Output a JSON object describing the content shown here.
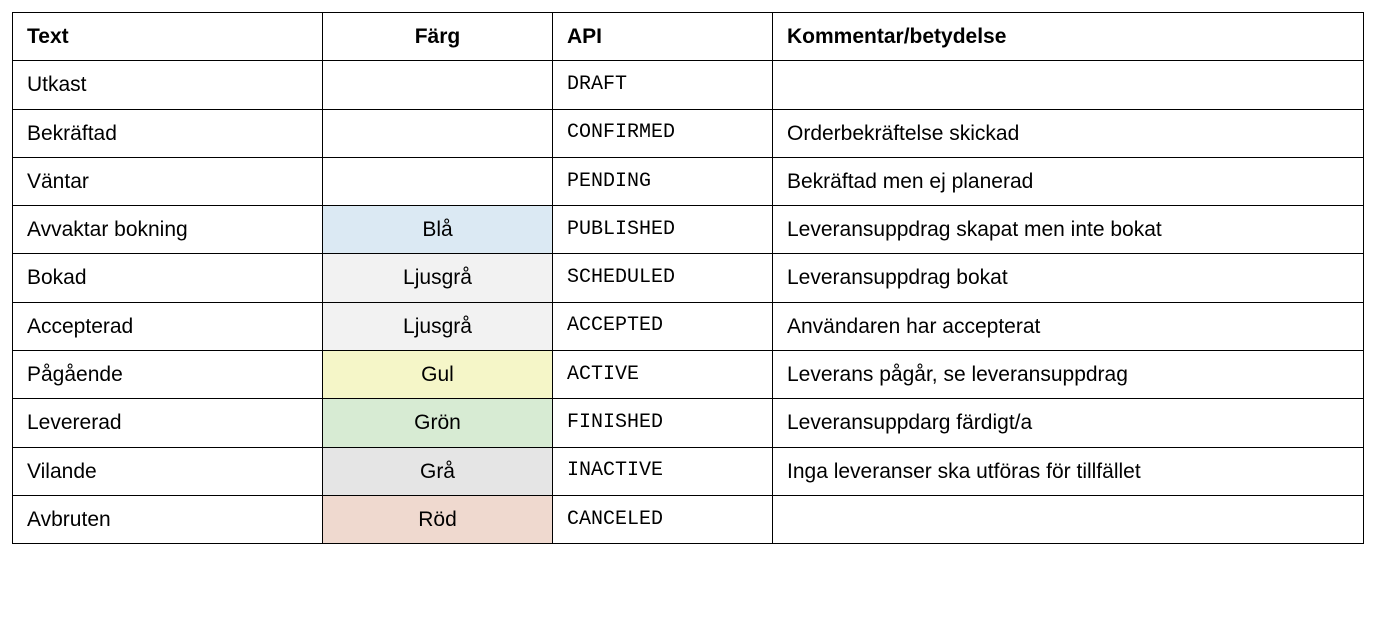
{
  "table": {
    "headers": {
      "text": "Text",
      "farg": "Färg",
      "api": "API",
      "kommentar": "Kommentar/betydelse"
    },
    "rows": [
      {
        "text": "Utkast",
        "farg": "",
        "api": "DRAFT",
        "kommentar": "",
        "farg_class": ""
      },
      {
        "text": "Bekräftad",
        "farg": "",
        "api": "CONFIRMED",
        "kommentar": "Orderbekräftelse skickad",
        "farg_class": ""
      },
      {
        "text": "Väntar",
        "farg": "",
        "api": "PENDING",
        "kommentar": "Bekräftad men ej planerad",
        "farg_class": ""
      },
      {
        "text": "Avvaktar bokning",
        "farg": "Blå",
        "api": "PUBLISHED",
        "kommentar": "Leveransuppdrag skapat men inte bokat",
        "farg_class": "bg-blue"
      },
      {
        "text": "Bokad",
        "farg": "Ljusgrå",
        "api": "SCHEDULED",
        "kommentar": "Leveransuppdrag bokat",
        "farg_class": "bg-lgrey"
      },
      {
        "text": "Accepterad",
        "farg": "Ljusgrå",
        "api": "ACCEPTED",
        "kommentar": "Användaren har accepterat",
        "farg_class": "bg-lgrey"
      },
      {
        "text": "Pågående",
        "farg": "Gul",
        "api": "ACTIVE",
        "kommentar": "Leverans pågår, se leveransuppdrag",
        "farg_class": "bg-yellow"
      },
      {
        "text": "Levererad",
        "farg": "Grön",
        "api": "FINISHED",
        "kommentar": "Leveransuppdarg färdigt/a",
        "farg_class": "bg-green"
      },
      {
        "text": "Vilande",
        "farg": "Grå",
        "api": "INACTIVE",
        "kommentar": "Inga leveranser ska utföras för tillfället",
        "farg_class": "bg-grey"
      },
      {
        "text": "Avbruten",
        "farg": "Röd",
        "api": "CANCELED",
        "kommentar": "",
        "farg_class": "bg-red"
      }
    ]
  }
}
